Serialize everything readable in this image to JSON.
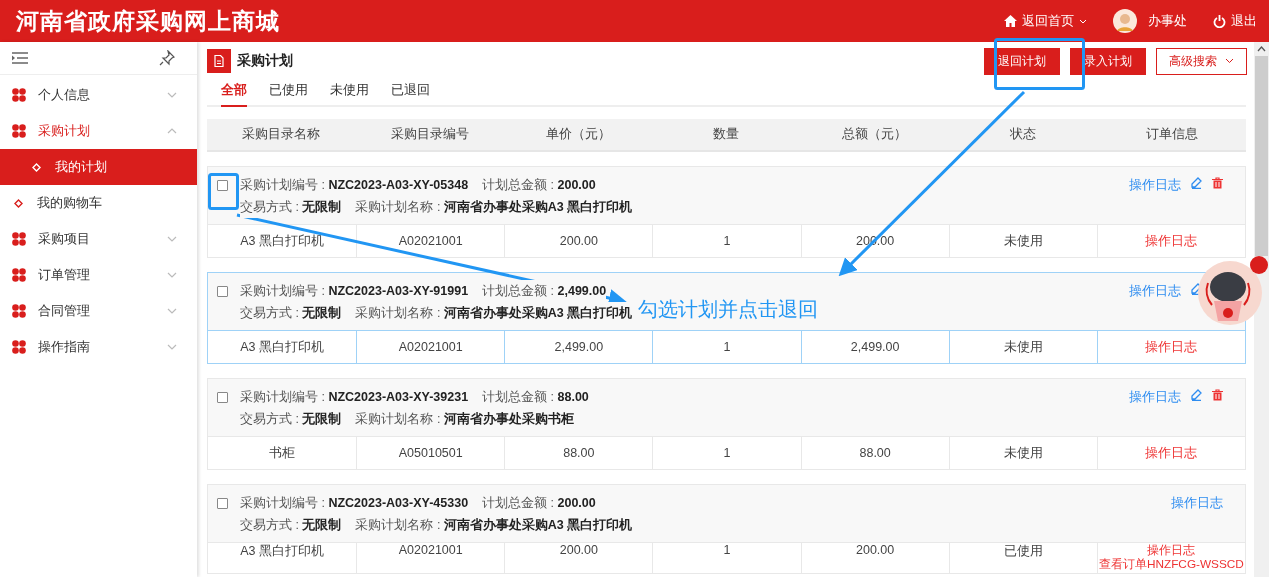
{
  "header": {
    "title": "河南省政府采购网上商城",
    "home": "返回首页",
    "user": "办事处",
    "logout": "退出"
  },
  "sidebar": {
    "items": [
      {
        "label": "个人信息",
        "kind": "group",
        "expanded": false,
        "active": false
      },
      {
        "label": "采购计划",
        "kind": "group",
        "expanded": true,
        "active": true,
        "children": [
          {
            "label": "我的计划",
            "selected": true
          }
        ]
      },
      {
        "label": "我的购物车",
        "kind": "link",
        "selected": false
      },
      {
        "label": "采购项目",
        "kind": "group",
        "expanded": false,
        "active": false
      },
      {
        "label": "订单管理",
        "kind": "group",
        "expanded": false,
        "active": false
      },
      {
        "label": "合同管理",
        "kind": "group",
        "expanded": false,
        "active": false
      },
      {
        "label": "操作指南",
        "kind": "group",
        "expanded": false,
        "active": false
      }
    ]
  },
  "page": {
    "title": "采购计划",
    "buttons": [
      {
        "label": "退回计划",
        "kind": "primary"
      },
      {
        "label": "录入计划",
        "kind": "primary"
      },
      {
        "label": "高级搜索",
        "kind": "outline"
      }
    ],
    "tabs": [
      {
        "label": "全部",
        "selected": true
      },
      {
        "label": "已使用",
        "selected": false
      },
      {
        "label": "未使用",
        "selected": false
      },
      {
        "label": "已退回",
        "selected": false
      }
    ],
    "columns": [
      "采购目录名称",
      "采购目录编号",
      "单价（元）",
      "数量",
      "总额（元）",
      "状态",
      "订单信息"
    ],
    "plans": [
      {
        "checked": false,
        "highlighted": false,
        "editable": true,
        "info": [
          [
            "采购计划编号 : **NZC2023-A03-XY-05348**",
            "计划总金额 : **200.00**"
          ],
          [
            "交易方式 : **无限制**",
            "采购计划名称 : **河南省办事处采购A3 黑白打印机**"
          ]
        ],
        "log": "操作日志",
        "rows": [
          {
            "cells": [
              "A3 黑白打印机",
              "A02021001",
              "200.00",
              "1",
              "200.00",
              "未使用"
            ],
            "links": [
              "操作日志"
            ]
          }
        ]
      },
      {
        "checked": false,
        "highlighted": true,
        "editable": true,
        "info": [
          [
            "采购计划编号 : **NZC2023-A03-XY-91991**",
            "计划总金额 : **2,499.00**"
          ],
          [
            "交易方式 : **无限制**",
            "采购计划名称 : **河南省办事处采购A3 黑白打印机**"
          ]
        ],
        "log": "操作日志",
        "rows": [
          {
            "cells": [
              "A3 黑白打印机",
              "A02021001",
              "2,499.00",
              "1",
              "2,499.00",
              "未使用"
            ],
            "links": [
              "操作日志"
            ]
          }
        ]
      },
      {
        "checked": false,
        "highlighted": false,
        "editable": true,
        "info": [
          [
            "采购计划编号 : **NZC2023-A03-XY-39231**",
            "计划总金额 : **88.00**"
          ],
          [
            "交易方式 : **无限制**",
            "采购计划名称 : **河南省办事处采购书柜**"
          ]
        ],
        "log": "操作日志",
        "rows": [
          {
            "cells": [
              "书柜",
              "A05010501",
              "88.00",
              "1",
              "88.00",
              "未使用"
            ],
            "links": [
              "操作日志"
            ]
          }
        ]
      },
      {
        "checked": false,
        "highlighted": false,
        "editable": false,
        "info": [
          [
            "采购计划编号 : **NZC2023-A03-XY-45330**",
            "计划总金额 : **200.00**"
          ],
          [
            "交易方式 : **无限制**",
            "采购计划名称 : **河南省办事处采购A3 黑白打印机**"
          ]
        ],
        "log": "操作日志",
        "rows": [
          {
            "cells": [
              "A3 黑白打印机",
              "A02021001",
              "200.00",
              "1",
              "200.00",
              "已使用"
            ],
            "links": [
              "操作日志",
              "查看订单HNZFCG-WSSCD"
            ]
          }
        ]
      }
    ]
  },
  "annotation": {
    "callout": "勾选计划并点击退回"
  }
}
